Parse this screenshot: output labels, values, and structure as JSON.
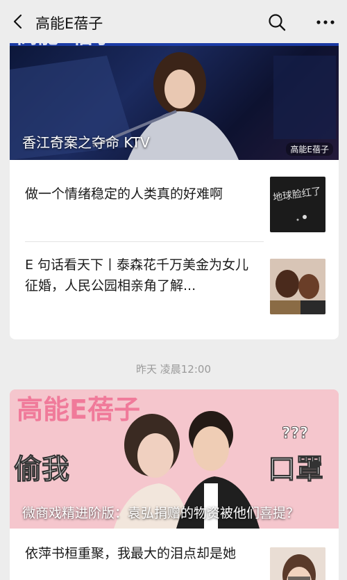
{
  "header": {
    "title": "高能E蓓子",
    "icons": {
      "back": "back-arrow-icon",
      "search": "search-icon",
      "more": "more-icon"
    }
  },
  "card1": {
    "cover": {
      "title": "香江奇案之夺命 KTV",
      "watermark": "高能E蓓子"
    },
    "items": [
      {
        "text": "做一个情绪稳定的人类真的好难啊"
      },
      {
        "text": "E 句话看天下丨泰森花千万美金为女儿征婚，人民公园相亲角了解..."
      }
    ]
  },
  "timestamp": "昨天 凌晨12:00",
  "card2": {
    "cover": {
      "title": "微商戏精进阶版：袁弘捐赠的物资被他们喜提？",
      "banner": "高能E蓓子",
      "left_text": "偷我",
      "right_text": "口罩"
    },
    "items": [
      {
        "text": "依萍书桓重聚，我最大的泪点却是她"
      }
    ]
  },
  "colors": {
    "background": "#ededed",
    "card": "#ffffff",
    "banner_pink": "#f07a9a"
  }
}
